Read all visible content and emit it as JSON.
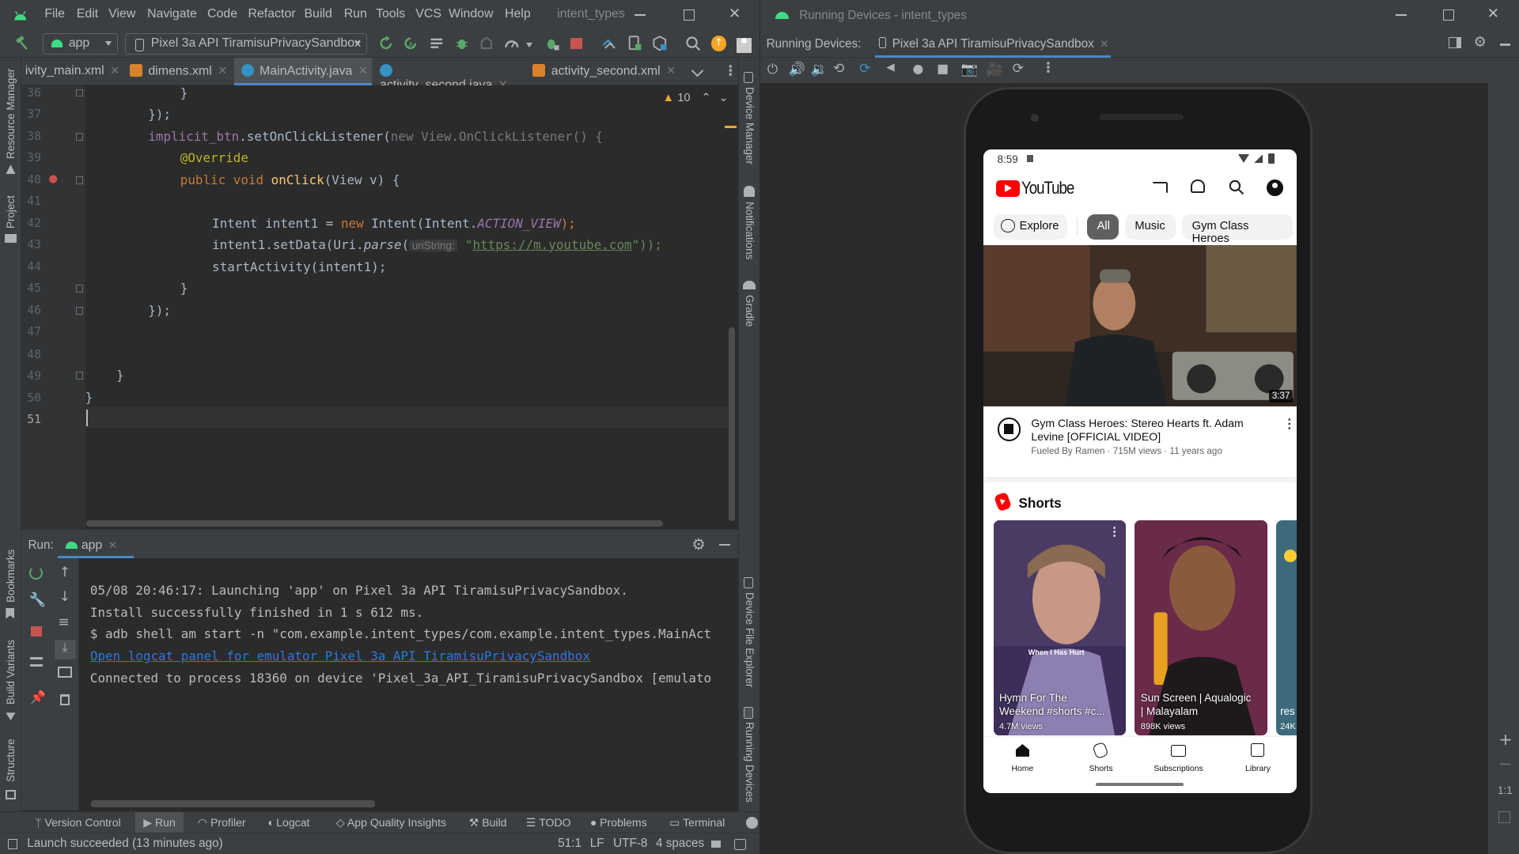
{
  "ide": {
    "menu": [
      "File",
      "Edit",
      "View",
      "Navigate",
      "Code",
      "Refactor",
      "Build",
      "Run",
      "Tools",
      "VCS",
      "Window",
      "Help"
    ],
    "project_title": "intent_types",
    "run_config": "app",
    "device": "Pixel 3a API TiramisuPrivacySandbox",
    "tabs": [
      "ivity_main.xml",
      "dimens.xml",
      "MainActivity.java",
      "activity_second.java",
      "activity_second.xml"
    ],
    "warnings_count": "10",
    "line_numbers": [
      "36",
      "37",
      "38",
      "39",
      "40",
      "41",
      "42",
      "43",
      "44",
      "45",
      "46",
      "47",
      "48",
      "49",
      "50",
      "51"
    ],
    "code": {
      "l36": "}",
      "l37": "});",
      "l38_a": "implicit_btn",
      "l38_b": ".setOnClickListener(",
      "l38_c": "new",
      "l38_d": " View.OnClickListener() {",
      "l39": "@Override",
      "l40_a": "public void ",
      "l40_b": "onClick",
      "l40_c": "(View v) {",
      "l42_a": "Intent intent1 = ",
      "l42_b": "new",
      "l42_c": " Intent(Intent.",
      "l42_d": "ACTION_VIEW",
      "l42_e": ");",
      "l43_a": "intent1.setData(Uri.",
      "l43_b": "parse",
      "l43_c": "(",
      "l43_hint": "uriString:",
      "l43_d": "\"",
      "l43_url": "https://m.youtube.com",
      "l43_e": "\"));",
      "l44": "startActivity(intent1);",
      "l45": "}",
      "l46": "});",
      "l49": "}",
      "l50": "}"
    },
    "side_left": [
      "Resource Manager",
      "Project",
      "Bookmarks",
      "Build Variants",
      "Structure"
    ],
    "side_right": [
      "Device Manager",
      "Notifications",
      "Gradle",
      "Device File Explorer",
      "Running Devices"
    ],
    "run_label": "Run:",
    "run_tab": "app",
    "console": [
      "05/08 20:46:17: Launching 'app' on Pixel 3a API TiramisuPrivacySandbox.",
      "Install successfully finished in 1 s 612 ms.",
      "$ adb shell am start -n \"com.example.intent_types/com.example.intent_types.MainAct",
      "Open logcat panel for emulator Pixel 3a API TiramisuPrivacySandbox",
      "Connected to process 18360 on device 'Pixel_3a_API_TiramisuPrivacySandbox [emulato"
    ],
    "bottom_tabs": [
      "Version Control",
      "Run",
      "Profiler",
      "Logcat",
      "App Quality Insights",
      "Build",
      "TODO",
      "Problems",
      "Terminal"
    ],
    "status": "Launch succeeded (13 minutes ago)",
    "cursor_pos": "51:1",
    "line_sep": "LF",
    "encoding": "UTF-8",
    "indent": "4 spaces"
  },
  "emulator": {
    "title": "Running Devices - intent_types",
    "label": "Running Devices:",
    "device_tab": "Pixel 3a API TiramisuPrivacySandbox",
    "zoom_label": "1:1"
  },
  "youtube": {
    "time": "8:59",
    "brand": "YouTube",
    "explore": "Explore",
    "chips": [
      "All",
      "Music",
      "Gym Class Heroes"
    ],
    "duration": "3:37",
    "video_title_1": "Gym Class Heroes: Stereo Hearts ft. Adam",
    "video_title_2": "Levine [OFFICIAL VIDEO]",
    "video_meta": "Fueled By Ramen · 715M views · 11 years ago",
    "shorts_title": "Shorts",
    "shorts": [
      {
        "title1": "Hymn For The",
        "title2": "Weekend  #shorts #c...",
        "views": "4.7M views",
        "overlay": "When I Has Hurt"
      },
      {
        "title1": "Sun Screen | Aqualogic",
        "title2": "| Malayalam",
        "views": "898K views"
      },
      {
        "title1": "res",
        "title2": "",
        "views": "24K"
      }
    ],
    "nav": [
      "Home",
      "Shorts",
      "Subscriptions",
      "Library"
    ]
  },
  "colors": {
    "accent": "#4a88c7",
    "youtube_red": "#ff0000"
  }
}
